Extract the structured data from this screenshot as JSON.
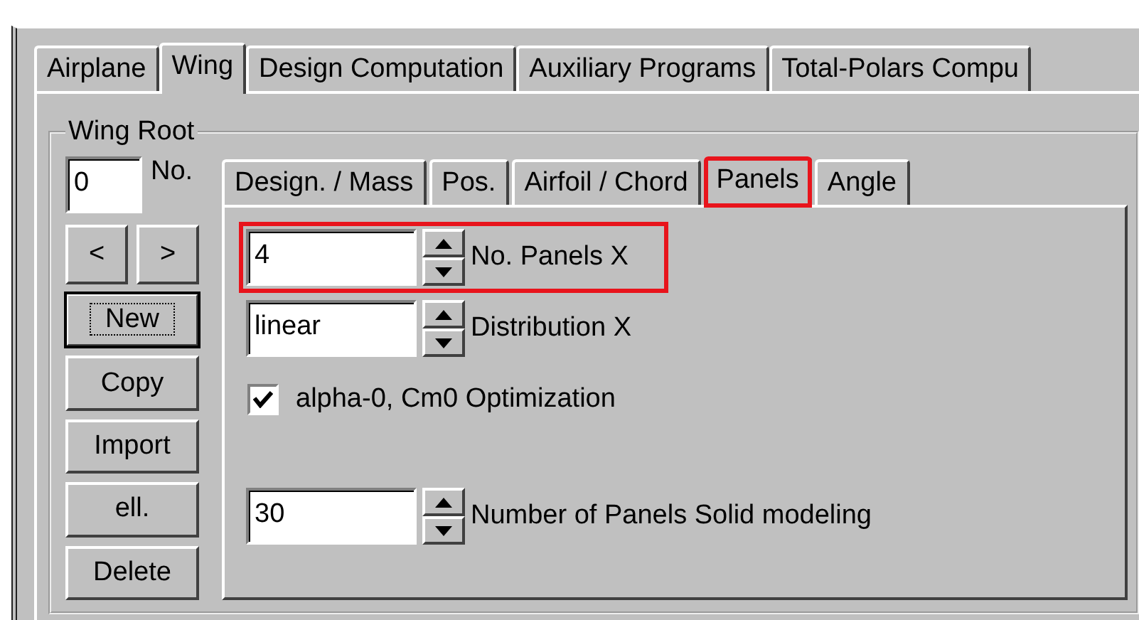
{
  "outer_tabs": [
    {
      "label": "Airplane",
      "selected": false
    },
    {
      "label": "Wing",
      "selected": true
    },
    {
      "label": "Design Computation",
      "selected": false
    },
    {
      "label": "Auxiliary Programs",
      "selected": false
    },
    {
      "label": "Total-Polars Compu",
      "selected": false
    }
  ],
  "group": {
    "title": "Wing Root"
  },
  "number": {
    "value": "0",
    "label": "No."
  },
  "nav_buttons": [
    "<",
    ">"
  ],
  "buttons": [
    {
      "label": "New",
      "default": true
    },
    {
      "label": "Copy",
      "default": false
    },
    {
      "label": "Import",
      "default": false
    },
    {
      "label": "ell.",
      "default": false
    },
    {
      "label": "Delete",
      "default": false
    }
  ],
  "inner_tabs": [
    {
      "label": "Design. / Mass",
      "selected": false,
      "highlighted": false
    },
    {
      "label": "Pos.",
      "selected": false,
      "highlighted": false
    },
    {
      "label": "Airfoil / Chord",
      "selected": false,
      "highlighted": false
    },
    {
      "label": "Panels",
      "selected": true,
      "highlighted": true
    },
    {
      "label": "Angle",
      "selected": false,
      "highlighted": false
    }
  ],
  "spinners": [
    {
      "value": "4",
      "label": "No. Panels X",
      "highlighted": true
    },
    {
      "value": "linear",
      "label": "Distribution X",
      "highlighted": false
    }
  ],
  "option": {
    "label": "alpha-0, Cm0 Optimization",
    "checked": true
  },
  "solid_spinner": {
    "value": "30",
    "label": "Number of Panels Solid modeling",
    "highlighted": false
  }
}
